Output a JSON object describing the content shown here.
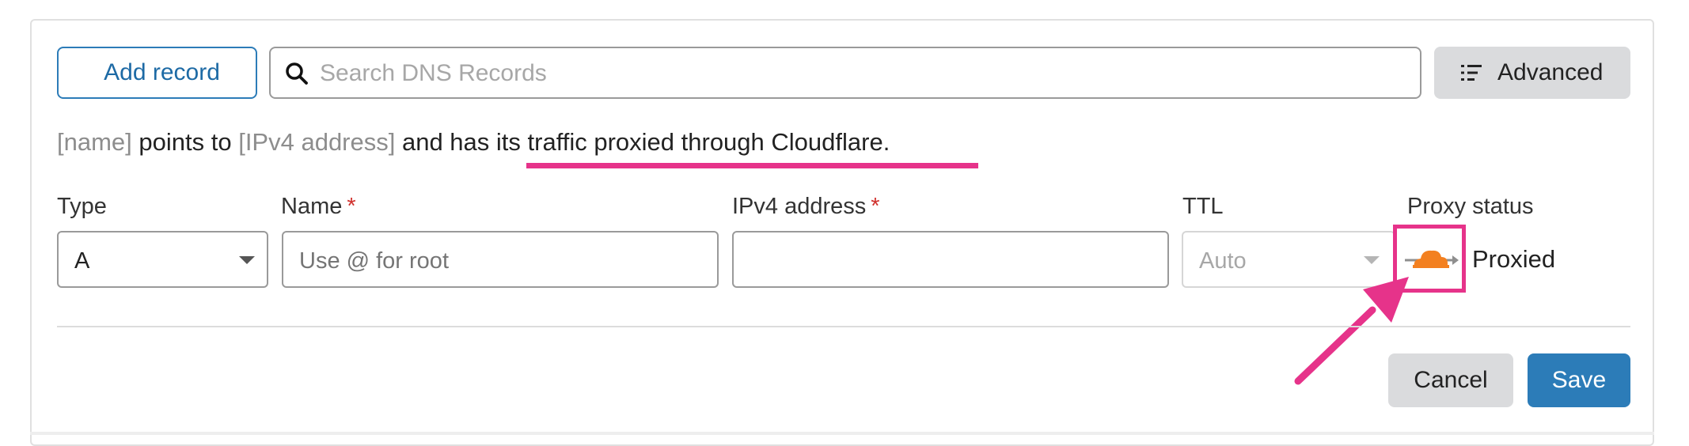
{
  "toolbar": {
    "add_record_label": "Add record",
    "search_placeholder": "Search DNS Records",
    "advanced_label": "Advanced",
    "search_icon": "search-icon",
    "advanced_icon": "list-icon"
  },
  "description": {
    "name_placeholder": "[name]",
    "text_1": " points to ",
    "ip_placeholder": "[IPv4 address]",
    "text_2": " and has its traffic proxied through Cloudflare."
  },
  "form": {
    "type": {
      "label": "Type",
      "value": "A"
    },
    "name": {
      "label": "Name",
      "required_mark": "*",
      "placeholder": "Use @ for root",
      "value": ""
    },
    "ipv4": {
      "label": "IPv4 address",
      "required_mark": "*",
      "value": ""
    },
    "ttl": {
      "label": "TTL",
      "value": "Auto",
      "disabled": true
    },
    "proxy": {
      "label": "Proxy status",
      "value": "Proxied",
      "icon": "cloud-proxy-icon",
      "cloud_color": "#f38020"
    }
  },
  "actions": {
    "cancel_label": "Cancel",
    "save_label": "Save"
  },
  "annotations": {
    "highlight_color": "#e6338a"
  },
  "colors": {
    "primary": "#2c7cb8",
    "secondary_button": "#dadbdd",
    "required": "#d0312d"
  }
}
